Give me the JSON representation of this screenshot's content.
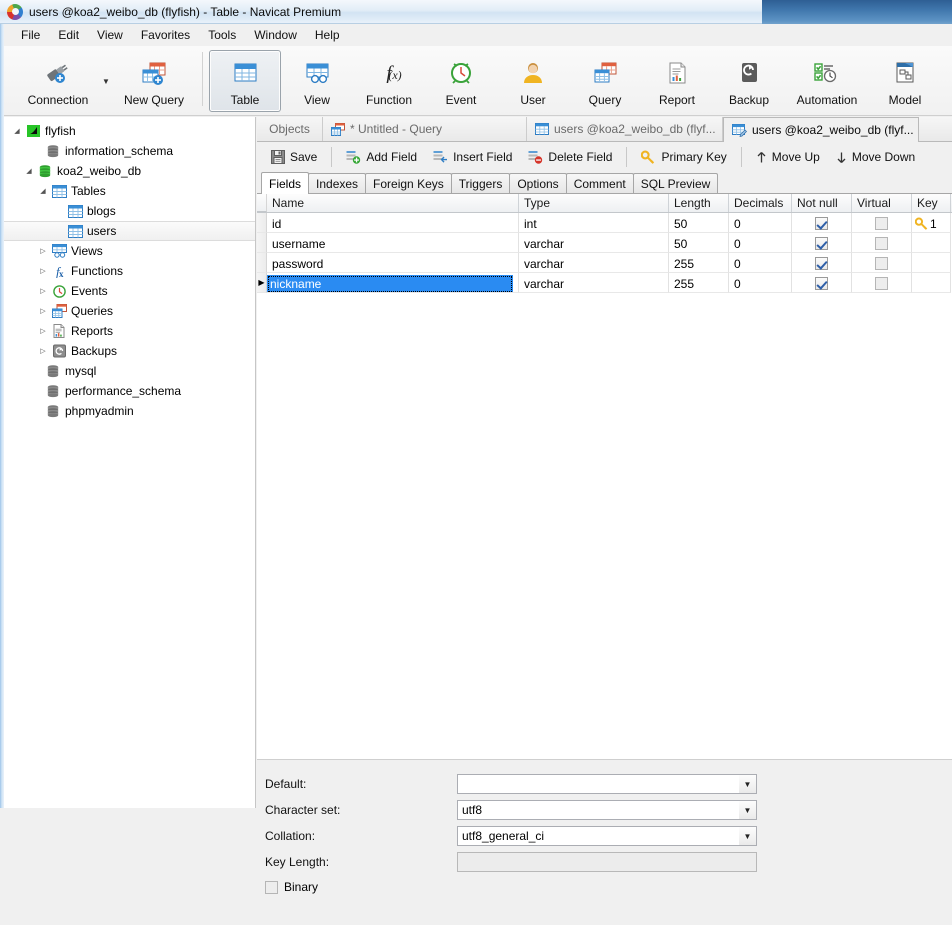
{
  "window": {
    "title": "users @koa2_weibo_db (flyfish) - Table - Navicat Premium"
  },
  "menubar": {
    "items": [
      "File",
      "Edit",
      "View",
      "Favorites",
      "Tools",
      "Window",
      "Help"
    ]
  },
  "toolbar": {
    "items": [
      {
        "label": "Connection",
        "icon": "connection-icon"
      },
      {
        "label": "New Query",
        "icon": "new-query-icon"
      },
      {
        "label": "Table",
        "icon": "table-icon",
        "active": true
      },
      {
        "label": "View",
        "icon": "view-icon"
      },
      {
        "label": "Function",
        "icon": "function-icon"
      },
      {
        "label": "Event",
        "icon": "event-icon"
      },
      {
        "label": "User",
        "icon": "user-icon"
      },
      {
        "label": "Query",
        "icon": "query-icon"
      },
      {
        "label": "Report",
        "icon": "report-icon"
      },
      {
        "label": "Backup",
        "icon": "backup-icon"
      },
      {
        "label": "Automation",
        "icon": "automation-icon"
      },
      {
        "label": "Model",
        "icon": "model-icon"
      }
    ]
  },
  "sidebar": {
    "items": [
      {
        "label": "flyfish",
        "indent": 0,
        "icon": "navicat-connection-icon",
        "expander": "expanded"
      },
      {
        "label": "information_schema",
        "indent": 1,
        "icon": "database-icon",
        "expander": "none"
      },
      {
        "label": "koa2_weibo_db",
        "indent": 1,
        "icon": "database-active-icon",
        "expander": "expanded"
      },
      {
        "label": "Tables",
        "indent": 2,
        "icon": "tables-icon",
        "expander": "expanded"
      },
      {
        "label": "blogs",
        "indent": 3,
        "icon": "table-icon",
        "expander": "none"
      },
      {
        "label": "users",
        "indent": 3,
        "icon": "table-icon",
        "expander": "none",
        "selected": true
      },
      {
        "label": "Views",
        "indent": 2,
        "icon": "views-icon",
        "expander": "collapsed"
      },
      {
        "label": "Functions",
        "indent": 2,
        "icon": "functions-icon",
        "expander": "collapsed"
      },
      {
        "label": "Events",
        "indent": 2,
        "icon": "events-icon",
        "expander": "collapsed"
      },
      {
        "label": "Queries",
        "indent": 2,
        "icon": "queries-icon",
        "expander": "collapsed"
      },
      {
        "label": "Reports",
        "indent": 2,
        "icon": "reports-icon",
        "expander": "collapsed"
      },
      {
        "label": "Backups",
        "indent": 2,
        "icon": "backups-icon",
        "expander": "collapsed"
      },
      {
        "label": "mysql",
        "indent": 1,
        "icon": "database-icon",
        "expander": "none"
      },
      {
        "label": "performance_schema",
        "indent": 1,
        "icon": "database-icon",
        "expander": "none"
      },
      {
        "label": "phpmyadmin",
        "indent": 1,
        "icon": "database-icon",
        "expander": "none"
      }
    ]
  },
  "tabs": [
    {
      "label": "Objects",
      "icon": "none",
      "active": false
    },
    {
      "label": "* Untitled - Query",
      "icon": "query-tab-icon",
      "active": false
    },
    {
      "label": "users @koa2_weibo_db (flyf...",
      "icon": "table-tab-icon",
      "active": false
    },
    {
      "label": "users @koa2_weibo_db (flyf...",
      "icon": "design-tab-icon",
      "active": true
    }
  ],
  "fieldbar": {
    "buttons": [
      {
        "label": "Save",
        "icon": "save-icon"
      },
      {
        "label": "Add Field",
        "icon": "add-field-icon"
      },
      {
        "label": "Insert Field",
        "icon": "insert-field-icon"
      },
      {
        "label": "Delete Field",
        "icon": "delete-field-icon"
      },
      {
        "label": "Primary Key",
        "icon": "key-icon"
      },
      {
        "label": "Move Up",
        "icon": "arrow-up-icon"
      },
      {
        "label": "Move Down",
        "icon": "arrow-down-icon"
      }
    ]
  },
  "subtabs": [
    {
      "label": "Fields",
      "active": true
    },
    {
      "label": "Indexes",
      "active": false
    },
    {
      "label": "Foreign Keys",
      "active": false
    },
    {
      "label": "Triggers",
      "active": false
    },
    {
      "label": "Options",
      "active": false
    },
    {
      "label": "Comment",
      "active": false
    },
    {
      "label": "SQL Preview",
      "active": false
    }
  ],
  "grid": {
    "columns": [
      "Name",
      "Type",
      "Length",
      "Decimals",
      "Not null",
      "Virtual",
      "Key"
    ],
    "rows": [
      {
        "name": "id",
        "type": "int",
        "length": "50",
        "decimals": "0",
        "not_null": true,
        "virtual": false,
        "key": "1",
        "key_icon": true,
        "selected": false,
        "editing": false
      },
      {
        "name": "username",
        "type": "varchar",
        "length": "50",
        "decimals": "0",
        "not_null": true,
        "virtual": false,
        "key": "",
        "key_icon": false,
        "selected": false,
        "editing": false
      },
      {
        "name": "password",
        "type": "varchar",
        "length": "255",
        "decimals": "0",
        "not_null": true,
        "virtual": false,
        "key": "",
        "key_icon": false,
        "selected": false,
        "editing": false
      },
      {
        "name": "nickname",
        "type": "varchar",
        "length": "255",
        "decimals": "0",
        "not_null": true,
        "virtual": false,
        "key": "",
        "key_icon": false,
        "selected": true,
        "editing": true
      }
    ]
  },
  "properties": {
    "default": {
      "label": "Default:",
      "value": "",
      "type": "dropdown"
    },
    "character_set": {
      "label": "Character set:",
      "value": "utf8",
      "type": "dropdown"
    },
    "collation": {
      "label": "Collation:",
      "value": "utf8_general_ci",
      "type": "dropdown"
    },
    "key_length": {
      "label": "Key Length:",
      "value": "",
      "type": "readonly"
    },
    "binary": {
      "label": "Binary",
      "checked": false,
      "type": "checkbox"
    }
  },
  "colors": {
    "selection_blue": "#2a8bf2",
    "accent_blue": "#3a8fd6",
    "key_gold": "#f0b422",
    "db_green": "#3aa33a"
  }
}
